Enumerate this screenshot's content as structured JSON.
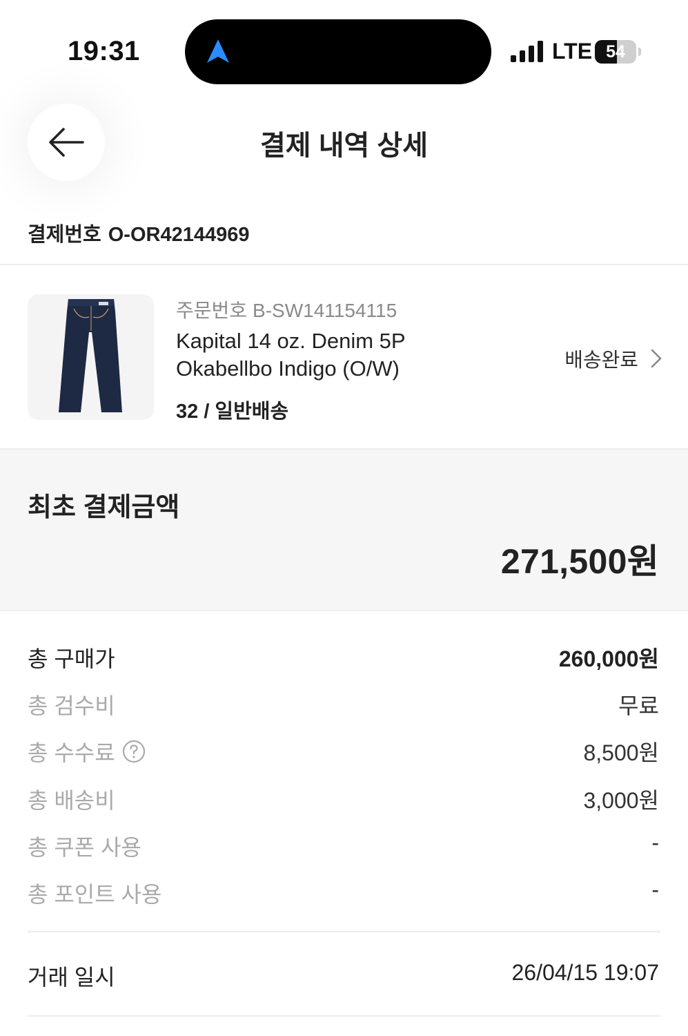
{
  "status_bar": {
    "time": "19:31",
    "network": "LTE",
    "battery_percent": 54,
    "battery_label": "54",
    "icons": [
      "navigation-arrow-icon",
      "signal-bars-icon",
      "battery-icon"
    ]
  },
  "header": {
    "title": "결제 내역 상세",
    "back_icon": "arrow-left-icon"
  },
  "payment": {
    "number_label": "결제번호",
    "number_value": "O-OR42144969"
  },
  "product": {
    "order_number_label": "주문번호",
    "order_number_value": "B-SW141154115",
    "name": "Kapital 14 oz. Denim 5P Okabellbo Indigo (O/W)",
    "option": "32 / 일반배송",
    "status": "배송완료",
    "status_icon": "chevron-right-icon",
    "image_icon": "jeans-icon"
  },
  "total": {
    "title": "최초 결제금액",
    "amount": "271,500원"
  },
  "breakdown": [
    {
      "label": "총 구매가",
      "value": "260,000원"
    },
    {
      "label": "총 검수비",
      "value": "무료"
    },
    {
      "label": "총 수수료",
      "value": "8,500원",
      "icon": "question-circle-icon"
    },
    {
      "label": "총 배송비",
      "value": "3,000원"
    },
    {
      "label": "총 쿠폰 사용",
      "value": "-"
    },
    {
      "label": "총 포인트 사용",
      "value": "-"
    }
  ],
  "trade": {
    "label": "거래 일시",
    "value": "26/04/15 19:07"
  },
  "colors": {
    "text_primary": "#222222",
    "text_muted": "#aaaaaa",
    "section_bg": "#f6f6f6",
    "nav_arrow": "#1e90ff",
    "island": "#000000"
  }
}
